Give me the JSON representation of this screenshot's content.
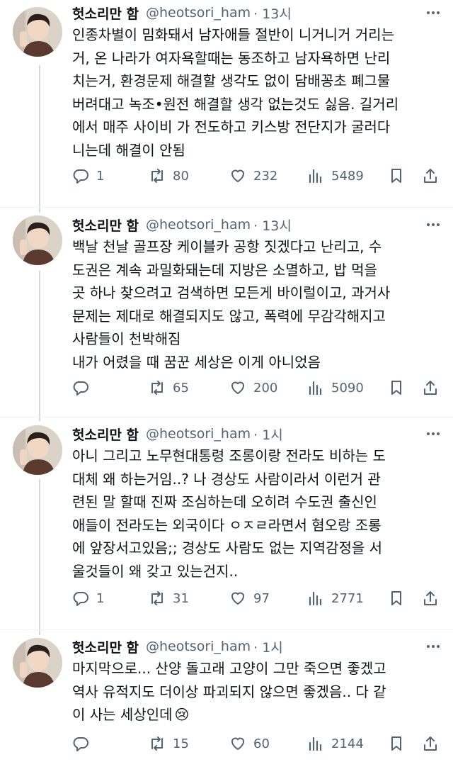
{
  "tweets": [
    {
      "name": "헛소리만 함",
      "handle": "@heotsori_ham",
      "time": "· 13시",
      "lines": [
        "인종차별이 밈화돼서 남자애들 절반이 니거니거 거리는",
        "거, 온 나라가 여자욕할때는 동조하고 남자욕하면 난리",
        "치는거, 환경문제 해결할 생각도 없이 담배꽁초 폐그물",
        "버려대고 녹조•원전 해결할 생각 없는것도 싫음. 길거리",
        "에서 매주 사이비 가 전도하고 키스방 전단지가 굴러다",
        "니는데 해결이 안됨"
      ],
      "replies": "1",
      "retweets": "80",
      "likes": "232",
      "views": "5489"
    },
    {
      "name": "헛소리만 함",
      "handle": "@heotsori_ham",
      "time": "· 13시",
      "lines": [
        "백날 천날 골프장 케이블카 공항 짓겠다고 난리고, 수",
        "도권은 계속 과밀화돼는데 지방은 소멸하고, 밥 먹을",
        "곳 하나 찾으려고 검색하면 모든게 바이럴이고, 과거사",
        "문제는 제대로 해결되지도 않고, 폭력에 무감각해지고",
        "사람들이 천박해짐",
        "내가 어렸을 때 꿈꾼 세상은 이게 아니었음"
      ],
      "replies": "",
      "retweets": "65",
      "likes": "200",
      "views": "5090"
    },
    {
      "name": "헛소리만 함",
      "handle": "@heotsori_ham",
      "time": "· 1시",
      "lines": [
        "아니 그리고 노무현대통령 조롱이랑 전라도 비하는 도",
        "대체 왜 하는거임..? 나 경상도 사람이라서 이런거 관",
        "련된 말 할때 진짜 조심하는데 오히려 수도권 출신인",
        "애들이 전라도는 외국이다 ㅇㅈㄹ라면서 혐오랑 조롱",
        "에 앞장서고있음;; 경상도 사람도 없는 지역감정을 서",
        "울것들이 왜 갖고 있는건지.."
      ],
      "replies": "1",
      "retweets": "31",
      "likes": "97",
      "views": "2771"
    },
    {
      "name": "헛소리만 함",
      "handle": "@heotsori_ham",
      "time": "· 1시",
      "lines": [
        "마지막으로... 산양 돌고래 고양이 그만 죽으면 좋겠고",
        "역사 유적지도 더이상 파괴되지 않으면 좋겠음.. 다 같",
        "이 사는 세상인데"
      ],
      "emoji": "😢",
      "replies": "",
      "retweets": "15",
      "likes": "60",
      "views": "2144"
    }
  ],
  "icons": {
    "reply": "reply-icon",
    "retweet": "retweet-icon",
    "like": "heart-icon",
    "views": "views-icon",
    "bookmark": "bookmark-icon",
    "share": "share-icon",
    "more": "more-icon"
  },
  "colors": {
    "text": "#0f1419",
    "secondary": "#536471",
    "thread_line": "#cfd9de"
  }
}
